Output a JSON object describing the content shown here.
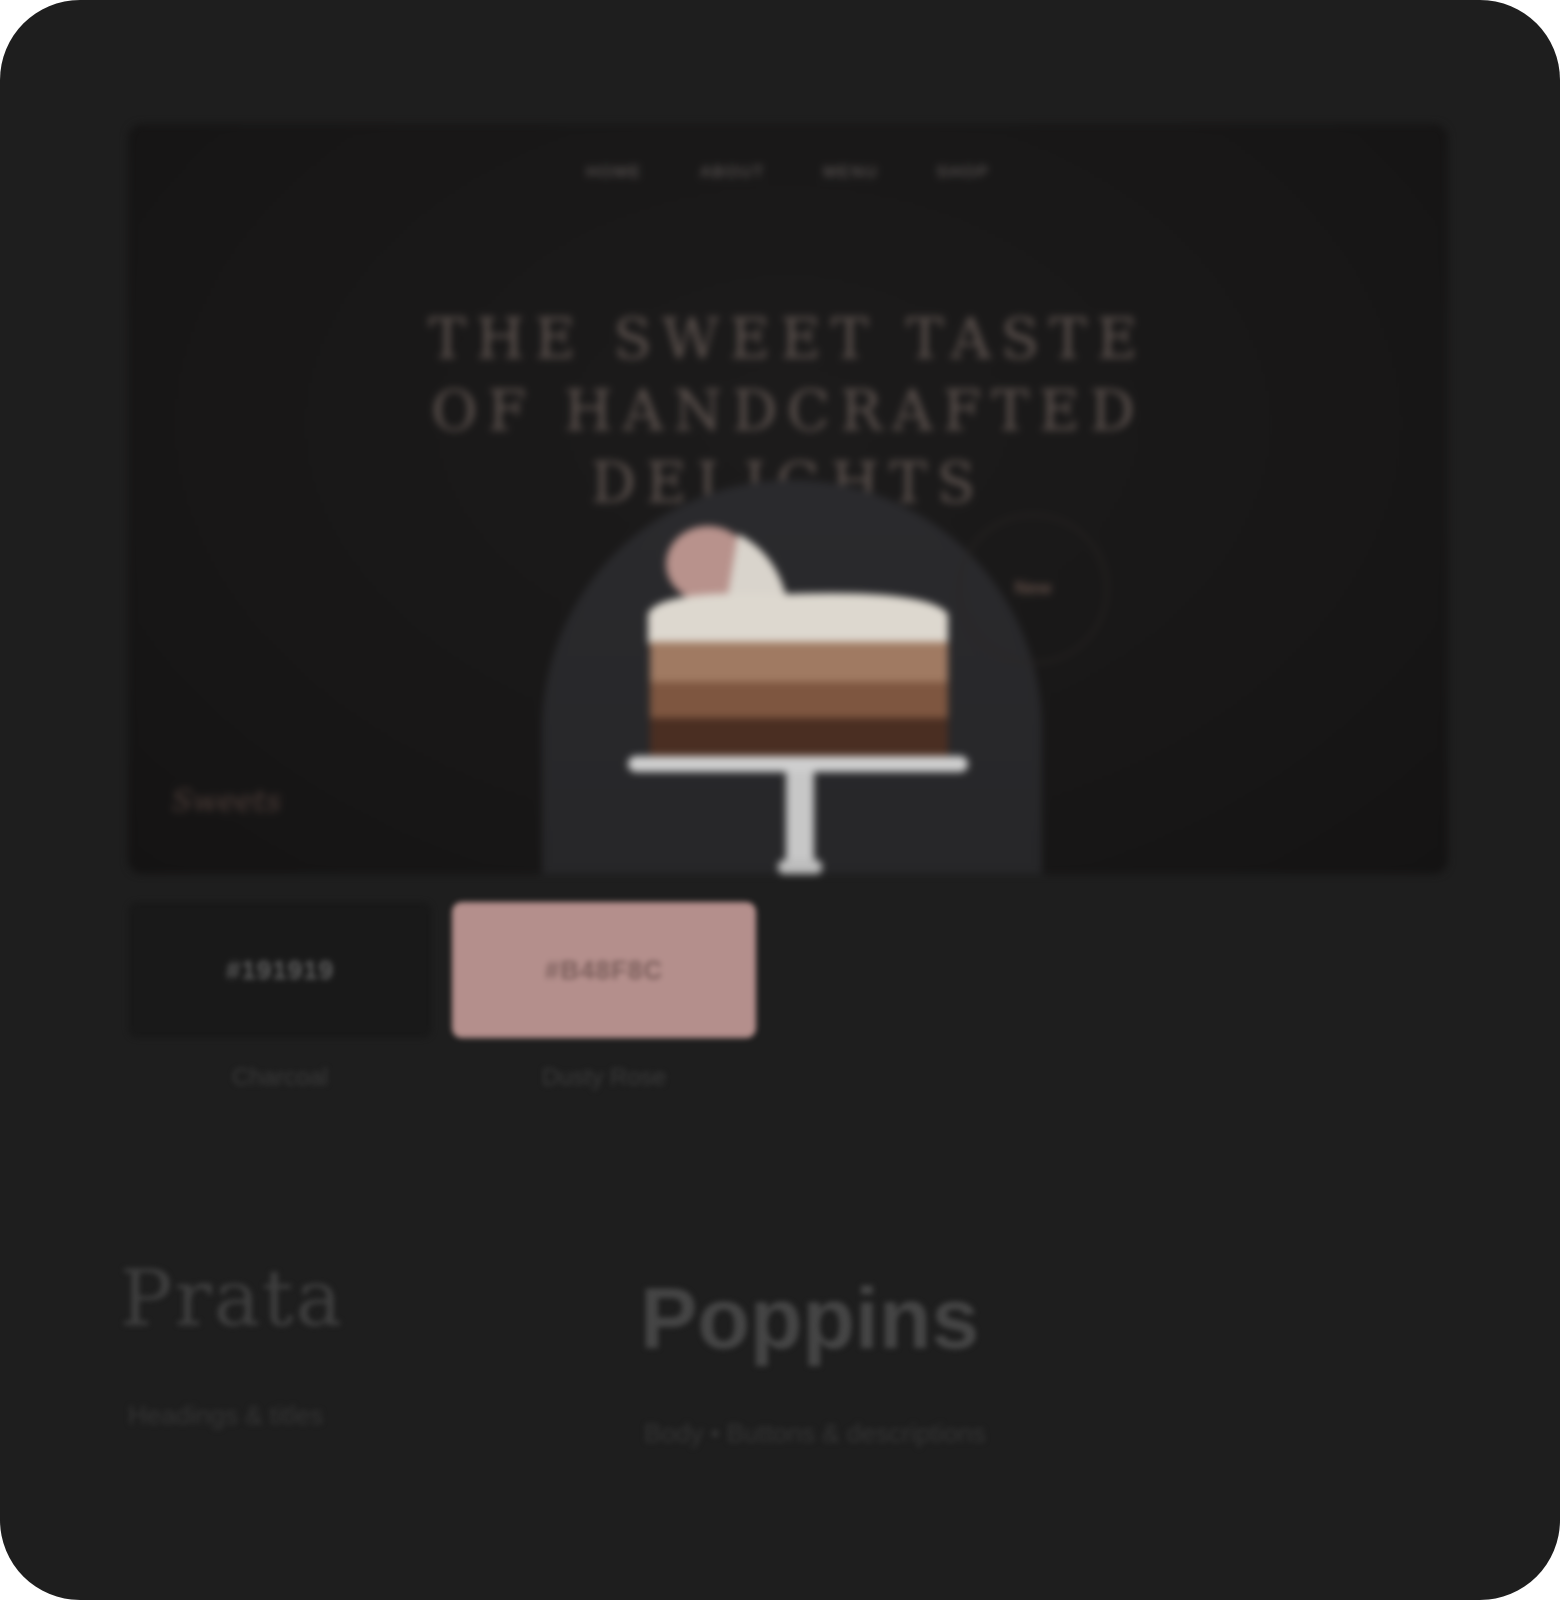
{
  "preview": {
    "nav_items": [
      "Home",
      "About",
      "Menu",
      "Shop"
    ],
    "headline_lines": [
      "The Sweet Taste",
      "Of Handcrafted",
      "Delights"
    ],
    "badge_label": "New",
    "brand_mark": "Sweets"
  },
  "palette": [
    {
      "name": "Charcoal",
      "hex": "#191919",
      "label": "#191919"
    },
    {
      "name": "Dusty Rose",
      "hex": "#B48F8C",
      "label": "#B48F8C"
    }
  ],
  "typography": {
    "heading_font": "Prata",
    "heading_caption": "Headings & titles",
    "body_font": "Poppins",
    "body_caption": "Body • Buttons & descriptions"
  },
  "colors": {
    "card_background": "#1e1e1e",
    "accent": "#b48f8c"
  }
}
